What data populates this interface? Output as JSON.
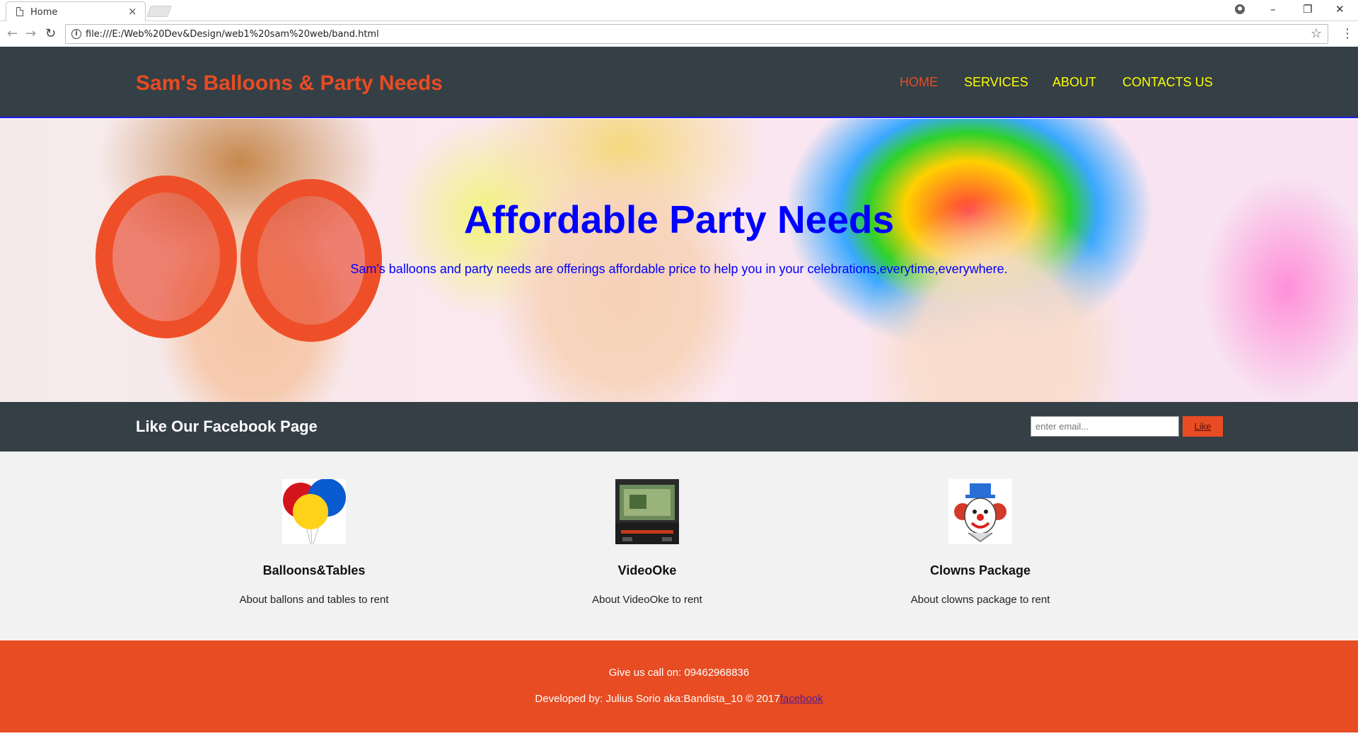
{
  "browser": {
    "tab_title": "Home",
    "tab_close": "×",
    "url": "file:///E:/Web%20Dev&Design/web1%20sam%20web/band.html",
    "window_buttons": {
      "minimize": "–",
      "restore": "❐",
      "close": "✕"
    },
    "nav_icons": {
      "back": "←",
      "forward": "→",
      "reload": "↻"
    },
    "info_icon": "i",
    "star": "☆",
    "menu": "⋮"
  },
  "header": {
    "brand": "Sam's Balloons & Party Needs",
    "nav": [
      {
        "label": "HOME",
        "active": true
      },
      {
        "label": "SERVICES",
        "active": false
      },
      {
        "label": "ABOUT",
        "active": false
      },
      {
        "label": "CONTACTS US",
        "active": false
      }
    ]
  },
  "hero": {
    "title": "Affordable Party Needs",
    "subtitle": "Sam's balloons and party needs are offerings affordable price to help you in your celebrations,everytime,everywhere."
  },
  "facebook": {
    "title": "Like Our Facebook Page",
    "email_placeholder": "enter email...",
    "like_label": "Like"
  },
  "services": [
    {
      "title": "Balloons&Tables",
      "desc": "About ballons and tables to rent",
      "icon": "balloons-icon"
    },
    {
      "title": "VideoOke",
      "desc": "About VideoOke to rent",
      "icon": "videoke-icon"
    },
    {
      "title": "Clowns Package",
      "desc": "About clowns package to rent",
      "icon": "clown-icon"
    }
  ],
  "footer": {
    "call": "Give us call on: 09462968836",
    "dev_prefix": "Developed by: Julius Sorio aka:Bandista_10 © 2017",
    "link": "facebook"
  },
  "colors": {
    "header_bg": "#353f46",
    "accent": "#e84c22",
    "nav_link": "#ffff00",
    "hero_text": "#0000ff"
  }
}
